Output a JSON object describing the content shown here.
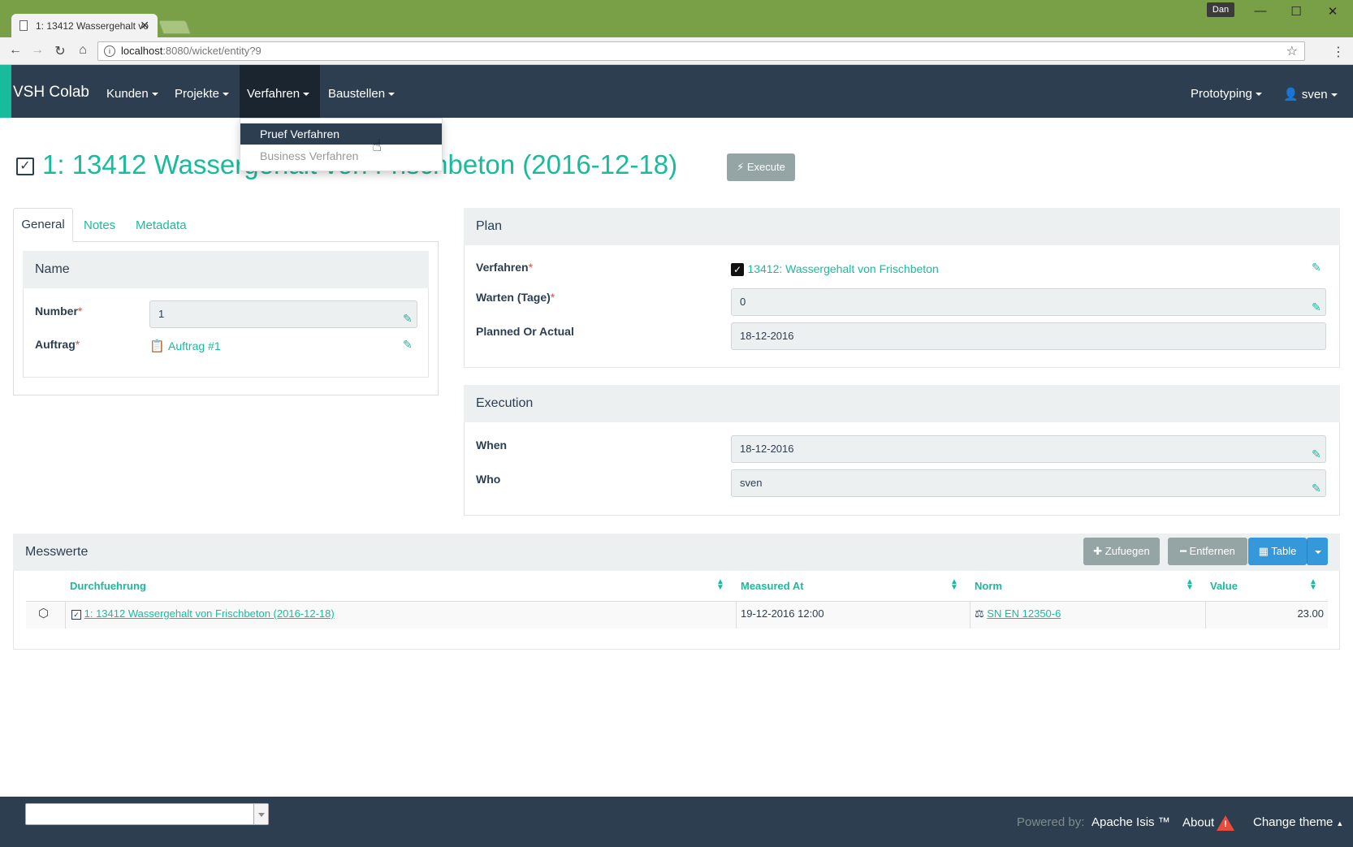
{
  "browser": {
    "tab_title": "1: 13412 Wassergehalt vo",
    "user_badge": "Dan",
    "url_host": "localhost",
    "url_path": ":8080/wicket/entity?9",
    "icons": [
      "back-icon",
      "forward-icon",
      "reload-icon",
      "home-icon",
      "info-icon",
      "star-icon",
      "menu-icon",
      "minimize-icon",
      "maximize-icon",
      "close-icon"
    ]
  },
  "navbar": {
    "brand": "VSH Colab",
    "items": [
      {
        "label": "Kunden"
      },
      {
        "label": "Projekte"
      },
      {
        "label": "Verfahren"
      },
      {
        "label": "Baustellen"
      }
    ],
    "right": [
      {
        "label": "Prototyping"
      },
      {
        "label": "sven"
      }
    ],
    "dropdown": [
      {
        "label": "Pruef Verfahren",
        "active": true
      },
      {
        "label": "Business Verfahren",
        "disabled": true
      }
    ]
  },
  "page": {
    "title": "1: 13412 Wassergehalt von Frischbeton (2016-12-18)",
    "execute_label": "Execute"
  },
  "left_tabs": [
    {
      "label": "General"
    },
    {
      "label": "Notes"
    },
    {
      "label": "Metadata"
    }
  ],
  "name_panel": {
    "heading": "Name",
    "number_label": "Number",
    "number_value": "1",
    "auftrag_label": "Auftrag",
    "auftrag_value": "Auftrag #1",
    "required_mark": "*"
  },
  "plan_panel": {
    "heading": "Plan",
    "verfahren_label": "Verfahren",
    "verfahren_value": "13412: Wassergehalt von Frischbeton",
    "warten_label": "Warten (Tage)",
    "warten_value": "0",
    "planned_label": "Planned Or Actual",
    "planned_value": "18-12-2016"
  },
  "execution_panel": {
    "heading": "Execution",
    "when_label": "When",
    "when_value": "18-12-2016",
    "who_label": "Who",
    "who_value": "sven"
  },
  "messwerte": {
    "heading": "Messwerte",
    "add_label": "Zufuegen",
    "remove_label": "Entfernen",
    "table_label": "Table",
    "columns": [
      "Durchfuehrung",
      "Measured At",
      "Norm",
      "Value"
    ],
    "rows": [
      {
        "durchfuehrung": "1: 13412 Wassergehalt von Frischbeton (2016-12-18)",
        "measured_at": "19-12-2016 12:00",
        "norm": "SN EN 12350-6",
        "value": "23.00"
      }
    ]
  },
  "footer": {
    "powered_by": "Powered by:",
    "apache": "Apache Isis ™",
    "about": "About",
    "theme": "Change theme"
  },
  "colors": {
    "navbar": "#2c3e50",
    "accent": "#18bc9c",
    "titlebar": "#7aa047",
    "danger": "#e74c3c",
    "gray_button": "#95a5a6",
    "primary_button": "#3498db"
  }
}
